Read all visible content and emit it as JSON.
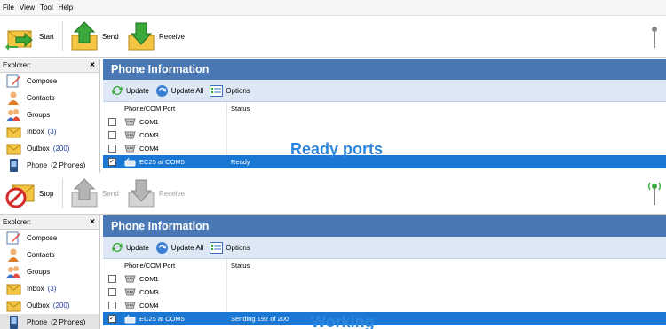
{
  "menu": [
    "File",
    "View",
    "Tool",
    "Help"
  ],
  "pane1": {
    "toolbar": {
      "start": "Start",
      "send": "Send",
      "receive": "Receive"
    },
    "explorer": {
      "title": "Explorer:",
      "close": "×",
      "items": [
        {
          "label": "Compose",
          "count": ""
        },
        {
          "label": "Contacts",
          "count": ""
        },
        {
          "label": "Groups",
          "count": ""
        },
        {
          "label": "Inbox",
          "count": "(3)"
        },
        {
          "label": "Outbox",
          "count": "(200)"
        },
        {
          "label": "Phone",
          "count": "(2 Phones)"
        }
      ]
    },
    "title": "Phone Information",
    "actions": {
      "update": "Update",
      "update_all": "Update All",
      "options": "Options"
    },
    "columns": {
      "port": "Phone/COM Port",
      "status": "Status"
    },
    "rows": [
      {
        "port": "COM1",
        "status": ""
      },
      {
        "port": "COM3",
        "status": ""
      },
      {
        "port": "COM4",
        "status": ""
      },
      {
        "port": "EC25 at COM5",
        "status": "Ready"
      }
    ],
    "overlay": "Ready ports"
  },
  "pane2": {
    "toolbar": {
      "stop": "Stop",
      "send": "Send",
      "receive": "Receive"
    },
    "explorer": {
      "title": "Explorer:",
      "close": "×",
      "items": [
        {
          "label": "Compose",
          "count": ""
        },
        {
          "label": "Contacts",
          "count": ""
        },
        {
          "label": "Groups",
          "count": ""
        },
        {
          "label": "Inbox",
          "count": "(3)"
        },
        {
          "label": "Outbox",
          "count": "(200)"
        },
        {
          "label": "Phone",
          "count": "(2 Phones)"
        }
      ]
    },
    "title": "Phone Information",
    "actions": {
      "update": "Update",
      "update_all": "Update All",
      "options": "Options"
    },
    "columns": {
      "port": "Phone/COM Port",
      "status": "Status"
    },
    "rows": [
      {
        "port": "COM1",
        "status": ""
      },
      {
        "port": "COM3",
        "status": ""
      },
      {
        "port": "COM4",
        "status": ""
      },
      {
        "port": "EC25 at COM5",
        "status": "Sending 192 of 200"
      }
    ],
    "overlay": "Working"
  },
  "icons": {
    "start": "start-envelope-icon",
    "stop": "stop-envelope-icon",
    "send": "send-up-arrow-icon",
    "receive": "receive-down-arrow-icon",
    "signal": "signal-antenna-icon"
  },
  "colors": {
    "title_bar": "#4a78b4",
    "selection": "#1a78d4",
    "overlay_text": "#2b86de",
    "action_bar": "#dde8f4"
  }
}
